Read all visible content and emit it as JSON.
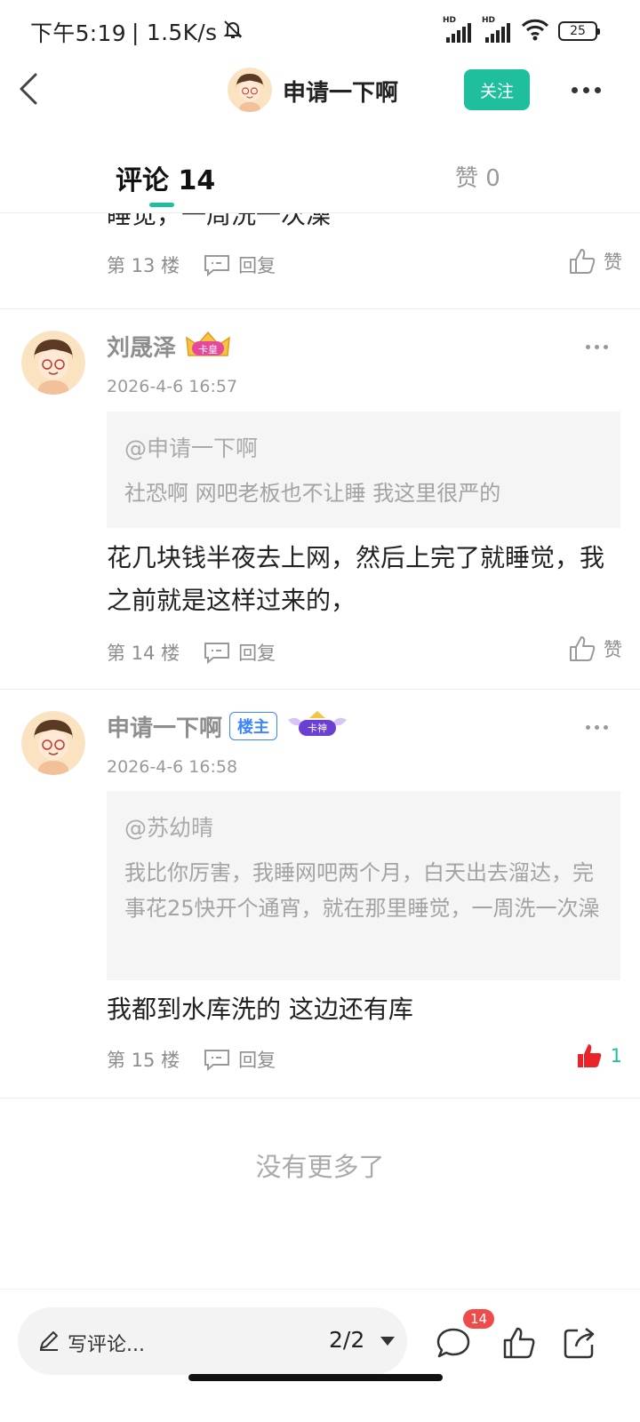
{
  "status_bar": {
    "time": "下午5:19",
    "speed": "| 1.5K/s",
    "hd_label": "HD",
    "battery": "25"
  },
  "header": {
    "title": "申请一下啊",
    "follow_label": "关注"
  },
  "tabs": {
    "comments_label": "评论 14",
    "likes_label": "赞 0"
  },
  "partial_comment": {
    "body_fragment": "睡觉，一周洗一次澡",
    "floor": "第 13 楼",
    "reply_label": "回复",
    "like_label": "赞"
  },
  "comments": [
    {
      "user": "刘晟泽",
      "badge": "卡皇",
      "time": "2026-4-6 16:57",
      "quote_at": "@申请一下啊",
      "quote_text": "社恐啊  网吧老板也不让睡 我这里很严的",
      "body": "花几块钱半夜去上网，然后上完了就睡觉，我之前就是这样过来的，",
      "floor": "第 14 楼",
      "reply_label": "回复",
      "like_label": "赞"
    },
    {
      "user": "申请一下啊",
      "owner_label": "楼主",
      "badge": "卡神",
      "time": "2026-4-6 16:58",
      "quote_at": "@苏幼晴",
      "quote_text": "我比你厉害，我睡网吧两个月，白天出去溜达，完事花25快开个通宵，就在那里睡觉，一周洗一次澡",
      "body": "我都到水库洗的 这边还有库",
      "floor": "第 15 楼",
      "reply_label": "回复",
      "like_count": "1"
    }
  ],
  "footer": {
    "no_more": "没有更多了"
  },
  "bottom_bar": {
    "placeholder": "写评论...",
    "page_indicator": "2/2",
    "comment_badge": "14"
  },
  "colors": {
    "accent": "#1fbf9e",
    "liked_red": "#e8232a",
    "owner_blue": "#3a86ff"
  }
}
